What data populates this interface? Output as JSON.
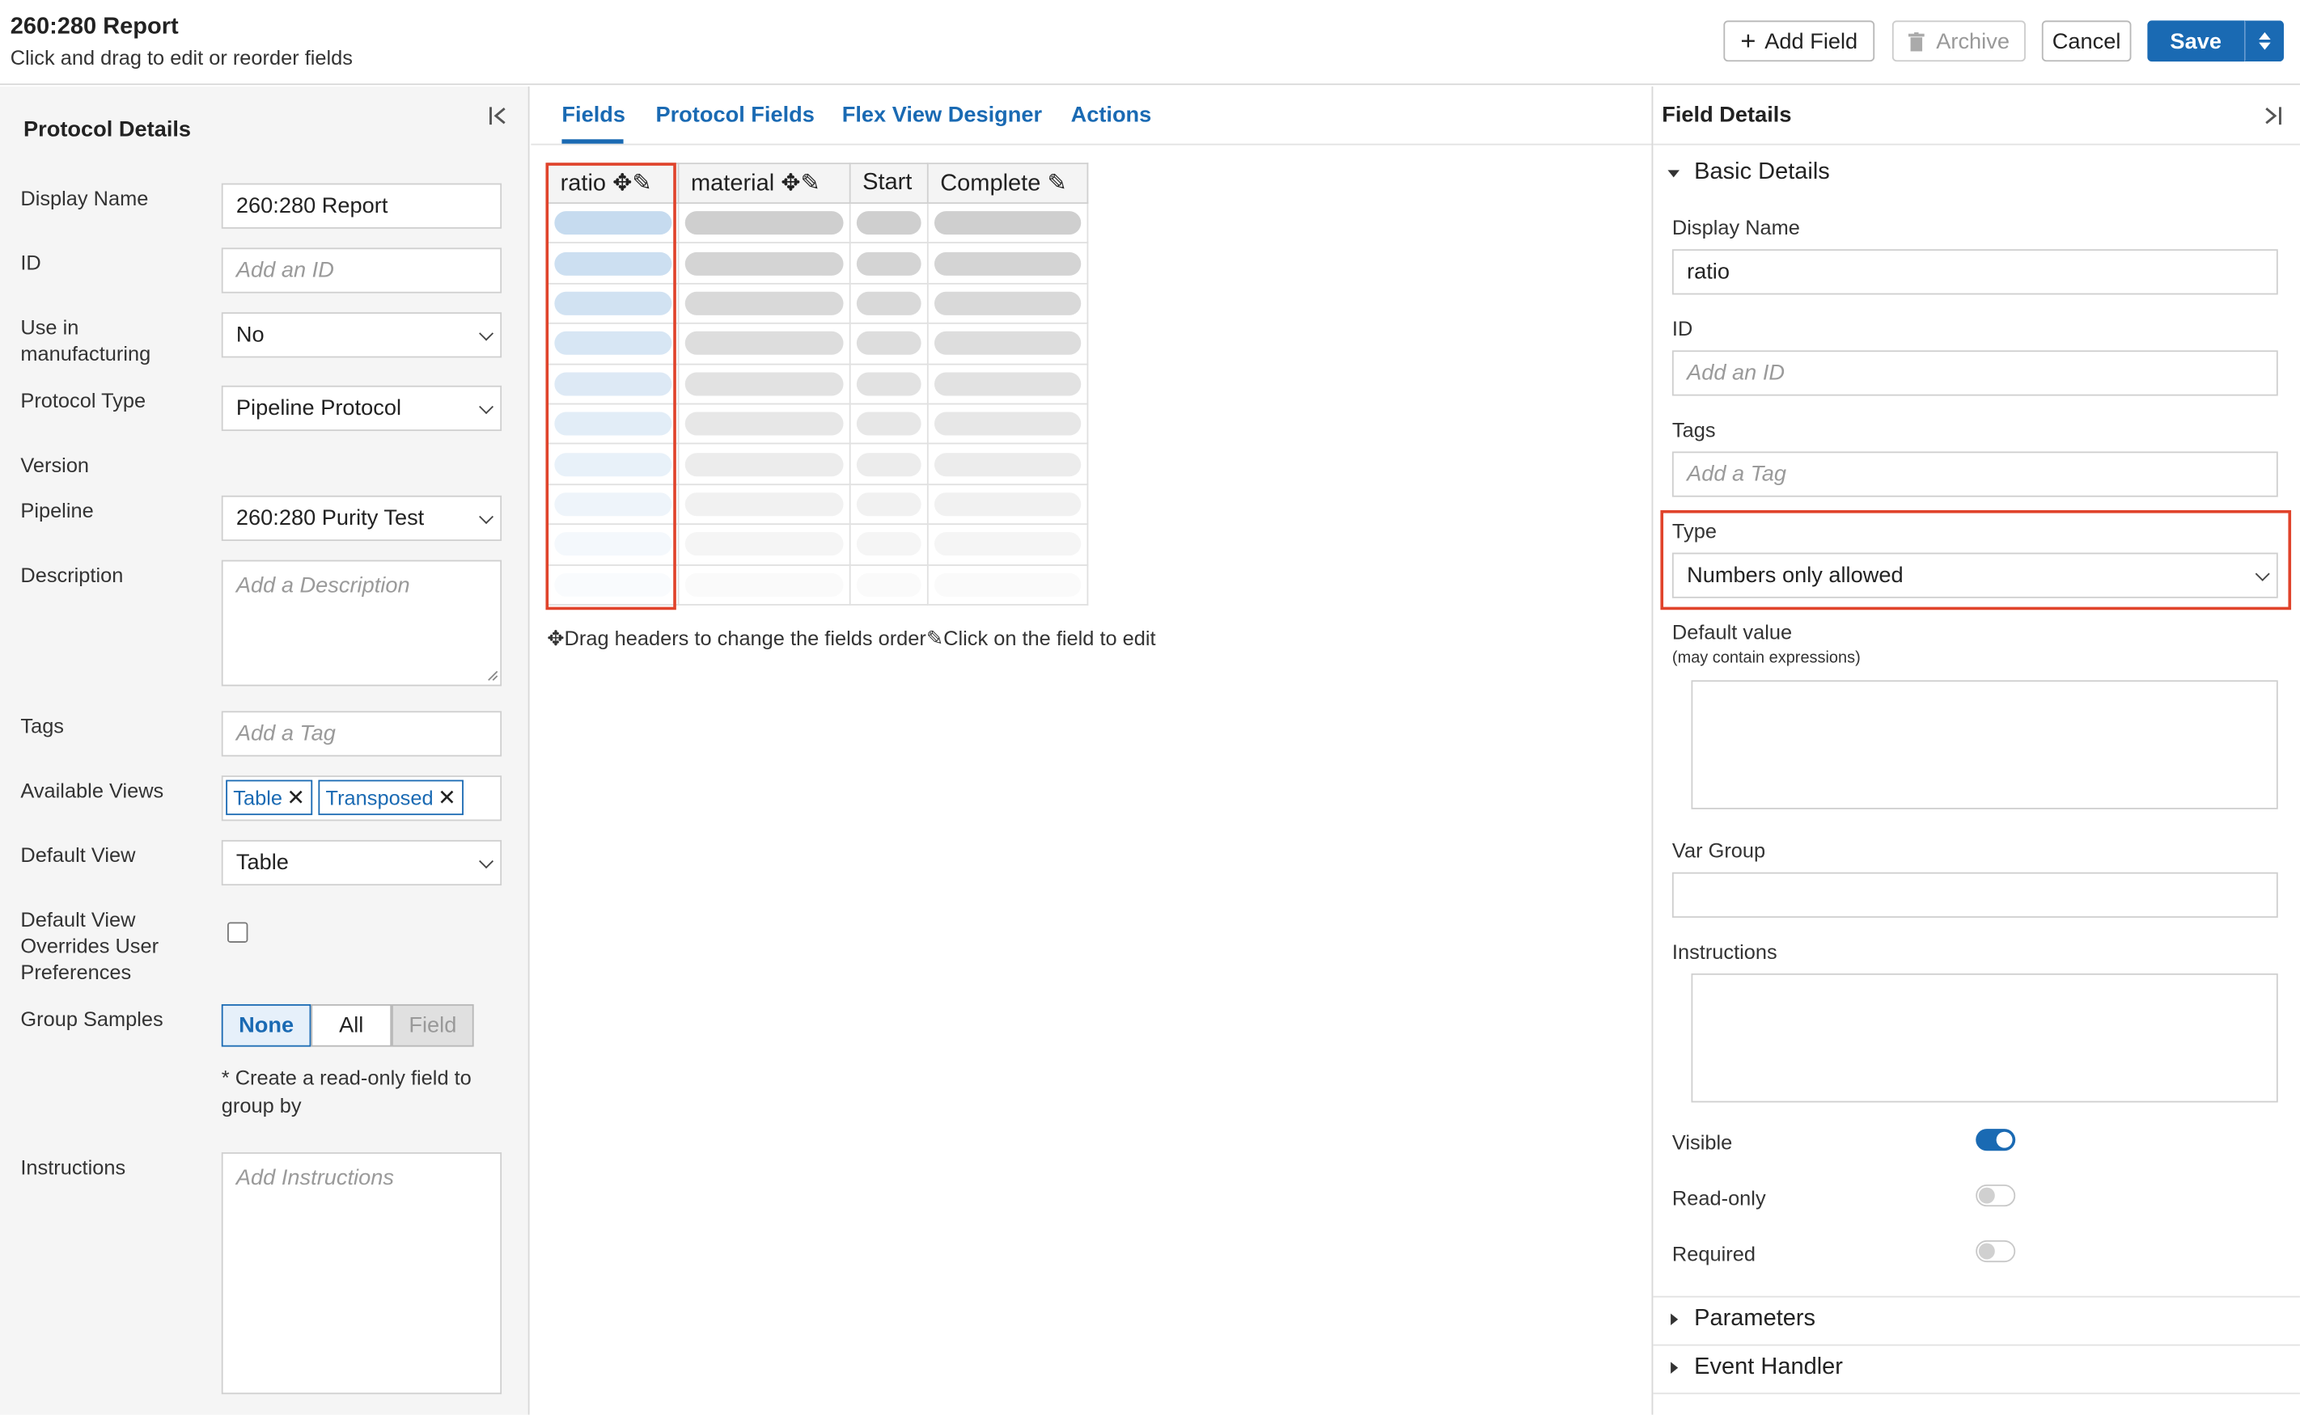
{
  "header": {
    "title": "260:280 Report",
    "subtitle": "Click and drag to edit or reorder fields",
    "buttons": {
      "add_field": "Add Field",
      "archive": "Archive",
      "cancel": "Cancel",
      "save": "Save"
    }
  },
  "left_panel": {
    "title": "Protocol Details",
    "display_name": {
      "label": "Display Name",
      "value": "260:280 Report"
    },
    "id": {
      "label": "ID",
      "placeholder": "Add an ID"
    },
    "use_in_manufacturing": {
      "label": "Use in manufacturing",
      "value": "No"
    },
    "protocol_type": {
      "label": "Protocol Type",
      "value": "Pipeline Protocol"
    },
    "version": {
      "label": "Version"
    },
    "pipeline": {
      "label": "Pipeline",
      "value": "260:280 Purity Test"
    },
    "description": {
      "label": "Description",
      "placeholder": "Add a Description"
    },
    "tags": {
      "label": "Tags",
      "placeholder": "Add a Tag"
    },
    "available_views": {
      "label": "Available Views",
      "chips": [
        "Table",
        "Transposed"
      ],
      "remove_glyph": "✕"
    },
    "default_view": {
      "label": "Default View",
      "value": "Table"
    },
    "default_view_overrides": {
      "label": "Default View Overrides User Preferences",
      "checked": false
    },
    "group_samples": {
      "label": "Group Samples",
      "options": [
        "None",
        "All",
        "Field"
      ],
      "selected": "None",
      "note": "* Create a read-only field to group by"
    },
    "instructions": {
      "label": "Instructions",
      "placeholder": "Add Instructions"
    }
  },
  "center": {
    "tabs": [
      "Fields",
      "Protocol Fields",
      "Flex View Designer",
      "Actions"
    ],
    "active_tab": "Fields",
    "columns": [
      {
        "name": "ratio",
        "move": true,
        "edit": true
      },
      {
        "name": "material",
        "move": true,
        "edit": true
      },
      {
        "name": "Start",
        "move": false,
        "edit": false
      },
      {
        "name": "Complete",
        "move": false,
        "edit": true
      }
    ],
    "hint_drag": "Drag headers to change the fields order",
    "hint_edit": "Click on the field to edit"
  },
  "right_panel": {
    "title": "Field Details",
    "basic_details": "Basic Details",
    "display_name": {
      "label": "Display Name",
      "value": "ratio"
    },
    "id": {
      "label": "ID",
      "placeholder": "Add an ID"
    },
    "tags": {
      "label": "Tags",
      "placeholder": "Add a Tag"
    },
    "type": {
      "label": "Type",
      "value": "Numbers only allowed"
    },
    "default_value": {
      "label": "Default value",
      "hint": "(may contain expressions)"
    },
    "var_group": {
      "label": "Var Group"
    },
    "instructions": {
      "label": "Instructions"
    },
    "visible": {
      "label": "Visible",
      "on": true
    },
    "read_only": {
      "label": "Read-only",
      "on": false
    },
    "required": {
      "label": "Required",
      "on": false
    },
    "parameters": "Parameters",
    "event_handler": "Event Handler"
  },
  "colors": {
    "accent": "#1a6ab3",
    "highlight": "#e0432b"
  }
}
